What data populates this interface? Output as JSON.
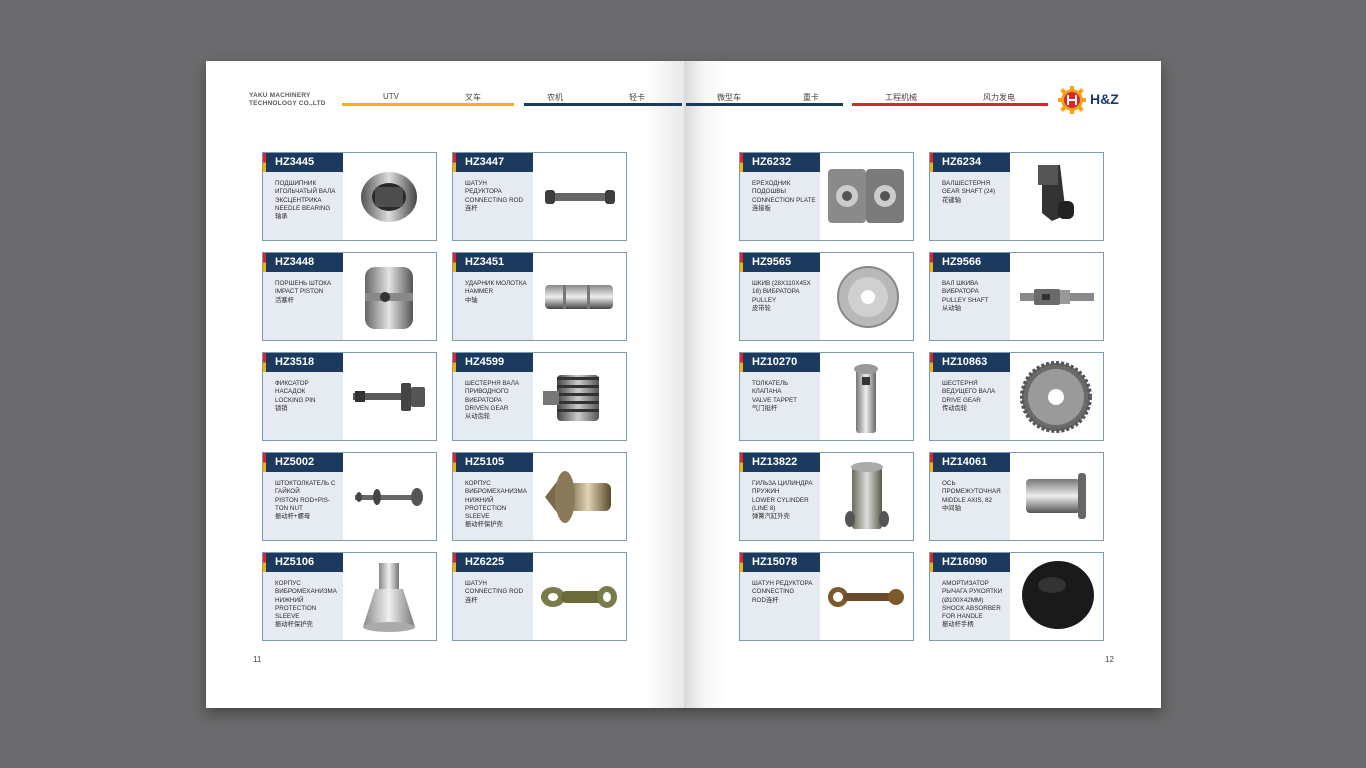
{
  "header": {
    "company_line1": "YAKU MACHINERY",
    "company_line2": "TECHNOLOGY CO.,LTD",
    "nav": [
      "UTV",
      "叉车",
      "农机",
      "轻卡",
      "微型车",
      "重卡",
      "工程机械",
      "风力发电"
    ],
    "logo_text": "H&Z"
  },
  "pages": {
    "left_number": "11",
    "right_number": "12"
  },
  "products": [
    {
      "code": "HZ3445",
      "lines": [
        "ПОДШИПНИК",
        "ИГОЛЬЧАТЫЙ ВАЛА",
        "ЭКСЦЕНТРИКА",
        "NEEDLE BEARING",
        "轴承"
      ]
    },
    {
      "code": "HZ3447",
      "lines": [
        "ШАТУН",
        "РЕДУКТОРА",
        "CONNECTING ROD",
        "连杆"
      ]
    },
    {
      "code": "HZ3448",
      "lines": [
        "ПОРШЕНЬ ШТОКА",
        "IMPACT PISTON",
        "活塞杆"
      ]
    },
    {
      "code": "HZ3451",
      "lines": [
        "УДАРНИК МОЛОТКА",
        "HAMMER",
        "中轴"
      ]
    },
    {
      "code": "HZ3518",
      "lines": [
        "ФИКСАТОР",
        "НАСАДОК",
        "LOCKING PIN",
        "锁销"
      ]
    },
    {
      "code": "HZ4599",
      "lines": [
        "ШЕСТЕРНЯ ВАЛА",
        "ПРИВОДНОГО",
        "ВИБРАТОРА",
        "DRIVEN GEAR",
        "从动齿轮"
      ]
    },
    {
      "code": "HZ5002",
      "lines": [
        "ШТОКТОЛКАТЕЛЬ С",
        "ГАЙКОЙ",
        "PISTON ROD+PIS-",
        "TON NUT",
        "振动杆+螺母"
      ]
    },
    {
      "code": "HZ5105",
      "lines": [
        "КОРПУС",
        "ВИБРОМЕХАНИЗМА",
        "НИЖНИЙ",
        "PROTECTION SLEEVE",
        "振动杆保护壳"
      ]
    },
    {
      "code": "HZ5106",
      "lines": [
        "КОРПУС",
        "ВИБРОМЕХАНИЗМА",
        "НИЖНИЙ",
        "PROTECTION SLEEVE",
        "振动杆保护壳"
      ]
    },
    {
      "code": "HZ6225",
      "lines": [
        "ШАТУН",
        "CONNECTING ROD",
        "连杆"
      ]
    },
    {
      "code": "HZ6232",
      "lines": [
        "ЕРЕХОДНИК",
        "ПОДОШВЫ",
        "CONNECTION PLATE",
        "连接板"
      ]
    },
    {
      "code": "HZ6234",
      "lines": [
        "ВАЛШЕСТЕРНЯ",
        "GEAR SHAFT (24)",
        "花键轴"
      ]
    },
    {
      "code": "HZ9565",
      "lines": [
        "ШКИВ (28X110X45X",
        "18) ВИБРАТОРА",
        "PULLEY",
        "皮带轮"
      ]
    },
    {
      "code": "HZ9566",
      "lines": [
        "ВАЛ ШКИВА",
        "ВИБРАТОРА",
        "PULLEY SHAFT",
        "从动轴"
      ]
    },
    {
      "code": "HZ10270",
      "lines": [
        "ТОЛКАТЕЛЬ",
        "КЛАПАНА",
        "VALVE TAPPET",
        "气门挺杆"
      ]
    },
    {
      "code": "HZ10863",
      "lines": [
        "ШЕСТЕРНЯ",
        "ВЕДУЩЕГО ВАЛА",
        "DRIVE GEAR",
        "传动齿轮"
      ]
    },
    {
      "code": "HZ13822",
      "lines": [
        "ГИЛЬЗА ЦИЛИНДРА",
        "ПРУЖИН",
        "LOWER CYLINDER",
        "(LINE 8)",
        "弹簧汽缸外壳"
      ]
    },
    {
      "code": "HZ14061",
      "lines": [
        "ОСЬ",
        "ПРОМЕЖУТОЧНАЯ",
        "MIDDLE AXIS, 82",
        "中间轴"
      ]
    },
    {
      "code": "HZ15078",
      "lines": [
        "ШАТУН РЕДУКТОРА",
        "CONNECTING",
        "ROD连杆"
      ]
    },
    {
      "code": "HZ16090",
      "lines": [
        "АМОРТИЗАТОР",
        "РЫЧАГА РУКОЯТКИ",
        "(Ø100X42MM)",
        "SHOCK ABSORBER",
        "FOR HANDLE",
        "振动杆手柄"
      ]
    }
  ]
}
